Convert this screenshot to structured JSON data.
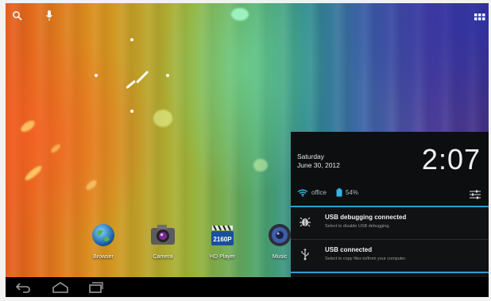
{
  "status_bar": {
    "search_icon": "search-icon",
    "mic_icon": "mic-icon",
    "apps_icon": "apps-grid-icon"
  },
  "dock": {
    "apps": [
      {
        "label": "Browser",
        "icon": "globe-icon"
      },
      {
        "label": "Camera",
        "icon": "camera-icon"
      },
      {
        "label": "HD Player",
        "icon": "hd-player-icon",
        "badge": "2160P"
      },
      {
        "label": "Music",
        "icon": "music-speaker-icon"
      }
    ]
  },
  "notification_panel": {
    "day": "Saturday",
    "date": "June 30, 2012",
    "time": "2:07",
    "wifi_name": "office",
    "battery": "54%",
    "accent": "#2f9ed1",
    "notifications": [
      {
        "icon": "usb-debug-icon",
        "title": "USB debugging connected",
        "subtitle": "Select to disable USB debugging."
      },
      {
        "icon": "usb-icon",
        "title": "USB connected",
        "subtitle": "Select to copy files to/from your computer."
      }
    ]
  },
  "nav_bar": {
    "back": "back-icon",
    "home": "home-icon",
    "recents": "recents-icon"
  }
}
